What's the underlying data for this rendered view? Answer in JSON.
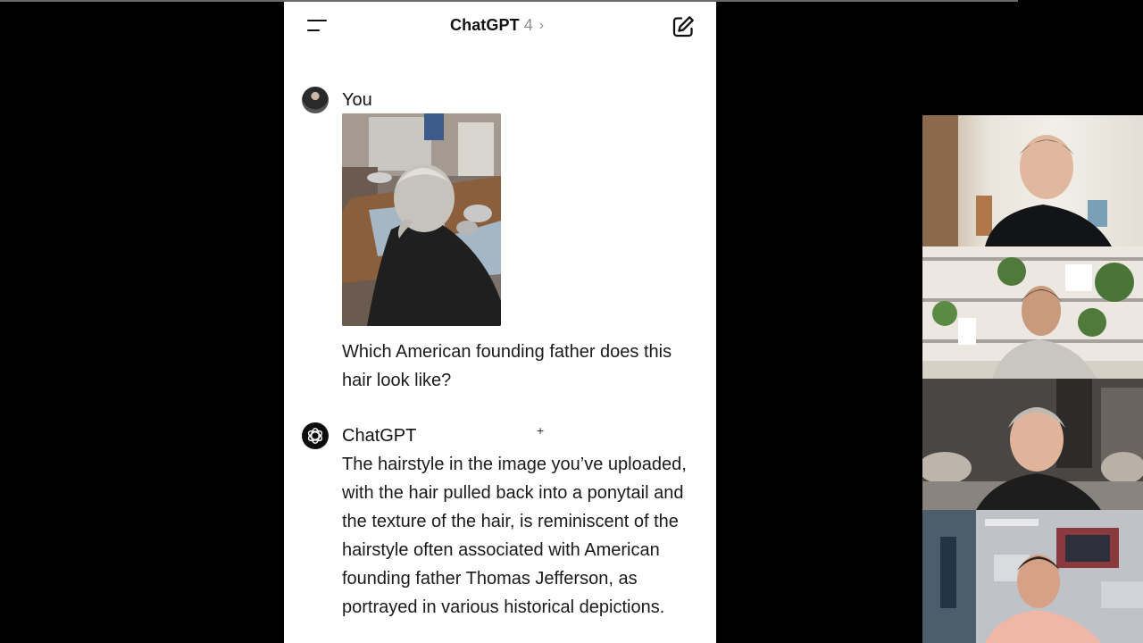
{
  "app": {
    "title": "ChatGPT",
    "version": "4",
    "chevron": "›"
  },
  "icons": {
    "menu": "menu-icon",
    "compose": "new-chat-icon",
    "chevron": "chevron-right-icon",
    "gpt_logo": "openai-logo-icon"
  },
  "conversation": {
    "user": {
      "name": "You",
      "image_alt": "photo of a person with gray hair pulled back, seated at a table",
      "message": "Which American founding father does this hair look like?"
    },
    "assistant": {
      "name": "ChatGPT",
      "message": "The hairstyle in the image you’ve uploaded, with the hair pulled back into a ponytail and the texture of the hair, is reminiscent of the hairstyle often associated with American founding father Thomas Jefferson, as portrayed in various historical depictions."
    }
  },
  "video_call": {
    "tiles": [
      "participant-1",
      "participant-2",
      "participant-3",
      "participant-4"
    ]
  },
  "colors": {
    "background": "#000000",
    "chat_bg": "#ffffff",
    "text": "#1a1a1a",
    "muted": "#8e8e8e"
  }
}
